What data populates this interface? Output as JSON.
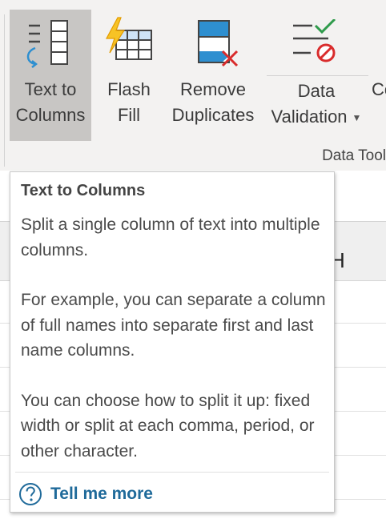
{
  "ribbon": {
    "buttons": [
      {
        "id": "text_to_columns",
        "line1": "Text to",
        "line2": "Columns"
      },
      {
        "id": "flash_fill",
        "line1": "Flash",
        "line2": "Fill"
      },
      {
        "id": "remove_duplicates",
        "line1": "Remove",
        "line2": "Duplicates"
      },
      {
        "id": "data_validation",
        "line1": "Data",
        "line2": "Validation"
      },
      {
        "id": "consolidate",
        "line1": "Co",
        "line2": ""
      }
    ],
    "group_label": "Data Tool"
  },
  "sheet": {
    "visible_column_header": "H"
  },
  "tooltip": {
    "title": "Text to Columns",
    "paragraphs": [
      "Split a single column of text into multiple columns.",
      "For example, you can separate a column of full names into separate first and last name columns.",
      "You can choose how to split it up: fixed width or split at each comma, period, or other character."
    ],
    "link_label": "Tell me more"
  },
  "colors": {
    "accent": "#1f6a9a",
    "selected_button": "#c8c6c4",
    "ribbon_bg": "#f3f2f1"
  },
  "icons": {
    "text_to_columns": "text-to-columns-icon",
    "flash_fill": "flash-fill-icon",
    "remove_duplicates": "remove-duplicates-icon",
    "data_validation": "data-validation-icon",
    "help": "help-circle-icon"
  }
}
